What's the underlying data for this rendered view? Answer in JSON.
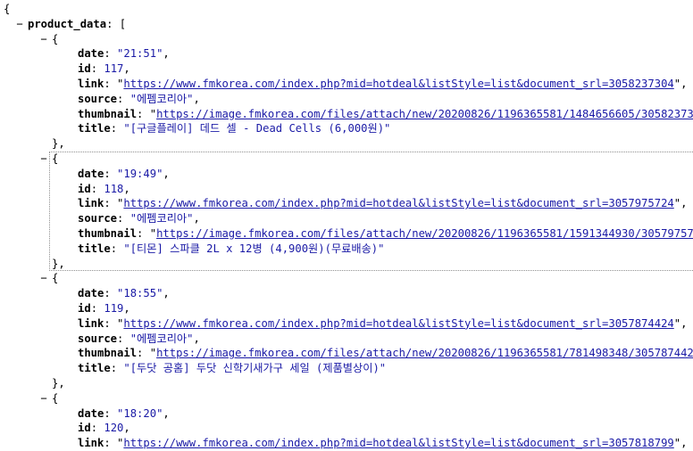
{
  "root_open": "{",
  "root_key": "product_data",
  "array_open": "[",
  "toggle_glyph": "−",
  "labels": {
    "date": "date",
    "id": "id",
    "link": "link",
    "source": "source",
    "thumbnail": "thumbnail",
    "title": "title"
  },
  "items": [
    {
      "date": "\"21:51\"",
      "id": "117",
      "link": "https://www.fmkorea.com/index.php?mid=hotdeal&listStyle=list&document_srl=3058237304",
      "source": "\"에펨코리아\"",
      "thumbnail": "https://image.fmkorea.com/files/attach/new/20200826/1196365581/1484656605/3058237304/",
      "title": "\"[구글플레이] 데드 셀 - Dead Cells (6,000원)\""
    },
    {
      "date": "\"19:49\"",
      "id": "118",
      "link": "https://www.fmkorea.com/index.php?mid=hotdeal&listStyle=list&document_srl=3057975724",
      "source": "\"에펨코리아\"",
      "thumbnail": "https://image.fmkorea.com/files/attach/new/20200826/1196365581/1591344930/3057975724/",
      "title": "\"[티몬] 스파클 2L x 12병 (4,900원)(무료배송)\""
    },
    {
      "date": "\"18:55\"",
      "id": "119",
      "link": "https://www.fmkorea.com/index.php?mid=hotdeal&listStyle=list&document_srl=3057874424",
      "source": "\"에펨코리아\"",
      "thumbnail": "https://image.fmkorea.com/files/attach/new/20200826/1196365581/781498348/3057874424/8",
      "title": "\"[두닷 공홈] 두닷 신학기새가구 세일 (제품별상이)\""
    },
    {
      "date": "\"18:20\"",
      "id": "120",
      "link": "https://www.fmkorea.com/index.php?mid=hotdeal&listStyle=list&document_srl=3057818799"
    }
  ]
}
